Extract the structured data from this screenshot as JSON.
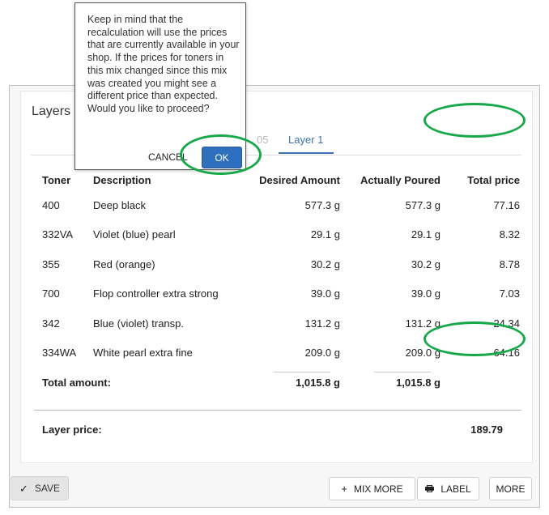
{
  "panel": {
    "title": "Layers",
    "tabs": [
      {
        "label": "05",
        "active": false
      },
      {
        "label": "Layer 1",
        "active": true
      }
    ]
  },
  "table": {
    "headers": [
      "Toner",
      "Description",
      "Desired Amount",
      "Actually Poured",
      "Total price"
    ],
    "rows": [
      {
        "toner": "400",
        "description": "Deep black",
        "desired": "577.3 g",
        "poured": "577.3 g",
        "total": "77.16"
      },
      {
        "toner": "332VA",
        "description": "Violet (blue) pearl",
        "desired": "29.1 g",
        "poured": "29.1 g",
        "total": "8.32"
      },
      {
        "toner": "355",
        "description": "Red (orange)",
        "desired": "30.2 g",
        "poured": "30.2 g",
        "total": "8.78"
      },
      {
        "toner": "700",
        "description": "Flop controller extra strong",
        "desired": "39.0 g",
        "poured": "39.0 g",
        "total": "7.03"
      },
      {
        "toner": "342",
        "description": "Blue (violet) transp.",
        "desired": "131.2 g",
        "poured": "131.2 g",
        "total": "24.34"
      },
      {
        "toner": "334WA",
        "description": "White pearl extra fine",
        "desired": "209.0 g",
        "poured": "209.0 g",
        "total": "64.16"
      }
    ],
    "total_label": "Total amount:",
    "total_desired": "1,015.8 g",
    "total_poured": "1,015.8 g"
  },
  "layer_price": {
    "label": "Layer price:",
    "value": "189.79"
  },
  "buttons": {
    "save": "SAVE",
    "mix_more": "MIX MORE",
    "label": "LABEL",
    "more": "MORE"
  },
  "dialog": {
    "message": "Keep in mind that the recalculation will use the prices that are currently available in your shop. If the prices for toners in this mix changed since this mix was created you might see a different price than expected. Would you like to proceed?",
    "cancel": "CANCEL",
    "ok": "OK"
  },
  "icons": {
    "save": "check-icon",
    "mix_more": "plus-icon",
    "label": "printer-icon"
  },
  "colors": {
    "accent": "#3d6fb6",
    "ok_button": "#2e6fbe",
    "highlight_ring": "#17a84a"
  }
}
